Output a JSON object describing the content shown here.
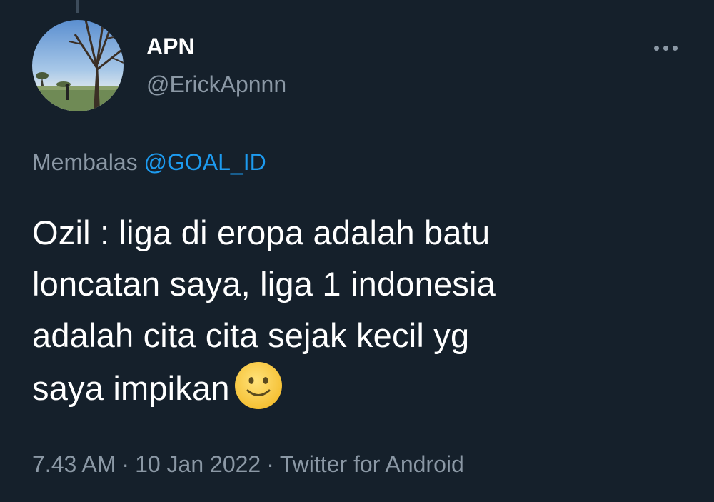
{
  "tweet": {
    "author_name": "APN",
    "author_handle": "@ErickApnnn",
    "replying_to_prefix": "Membalas",
    "replying_to_handle": "@GOAL_ID",
    "text_lines": [
      "Ozil : liga di eropa adalah batu",
      "loncatan saya, liga 1 indonesia",
      "adalah cita cita sejak kecil yg",
      "saya impikan"
    ],
    "emoji": "slightly-smiling-face",
    "time": "7.43 AM",
    "separator": "·",
    "date": "10 Jan 2022",
    "source": "Twitter for Android"
  },
  "icons": {
    "more": "more-horizontal-icon"
  },
  "colors": {
    "background": "#15202b",
    "text_primary": "#ffffff",
    "text_secondary": "#8b98a5",
    "accent": "#1d9bf0"
  }
}
